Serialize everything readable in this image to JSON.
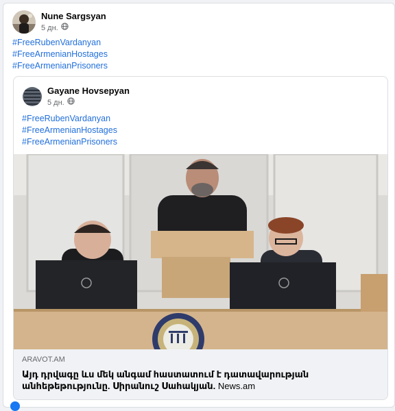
{
  "post": {
    "author": "Nune Sargsyan",
    "time": "5 дн.",
    "privacy_icon": "globe-icon",
    "hashtags": [
      "#FreeRubenVardanyan",
      "#FreeArmenianHostages",
      "#FreeArmenianPrisoners"
    ]
  },
  "shared_post": {
    "author": "Gayane Hovsepyan",
    "time": "5 дн.",
    "privacy_icon": "globe-icon",
    "hashtags": [
      "#FreeRubenVardanyan",
      "#FreeArmenianHostages",
      "#FreeArmenianPrisoners"
    ],
    "link": {
      "domain": "ARAVOT.AM",
      "title": "Այդ դրվագը ևս մեկ անգամ հաստատում է դատավարության անհեթեթությունը. Սիրանուշ Սահակյան.",
      "source": "News.am"
    }
  },
  "colors": {
    "link": "#216fdb",
    "secondary_text": "#65676b",
    "footer_bg": "#f0f2f5"
  }
}
